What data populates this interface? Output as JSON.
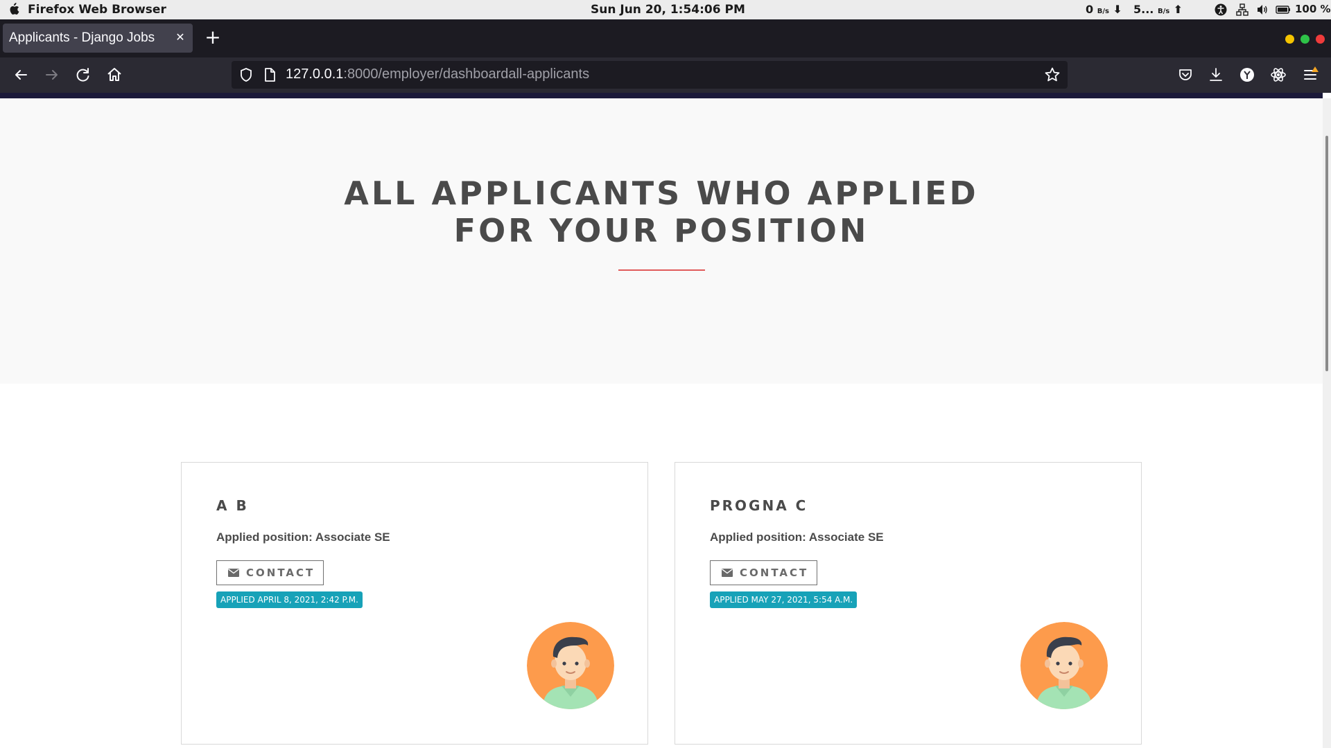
{
  "os": {
    "app_name": "Firefox Web Browser",
    "clock": "Sun Jun 20,  1:54:06 PM",
    "net_down_value": "0",
    "net_down_unit": "B/s",
    "net_up_value": "5...",
    "net_up_unit": "B/s",
    "battery": "100 %"
  },
  "browser": {
    "tab_title": "Applicants - Django Jobs",
    "url_host": "127.0.0.1",
    "url_path": ":8000/employer/dashboardall-applicants"
  },
  "page": {
    "title_line1": "ALL APPLICANTS WHO APPLIED",
    "title_line2": "FOR YOUR POSITION",
    "accent_color": "#e05a5a",
    "badge_color": "#17a2b8",
    "applicants": [
      {
        "name": "A B",
        "position": "Applied position: Associate SE",
        "contact_label": "CONTACT",
        "applied": "APPLIED APRIL 8, 2021, 2:42 P.M."
      },
      {
        "name": "PROGNA C",
        "position": "Applied position: Associate SE",
        "contact_label": "CONTACT",
        "applied": "APPLIED MAY 27, 2021, 5:54 A.M."
      }
    ]
  },
  "icons": [
    "apple-icon",
    "download-arrow-icon",
    "upload-arrow-icon",
    "accessibility-icon",
    "network-icon",
    "volume-icon",
    "battery-icon",
    "close-icon",
    "plus-icon",
    "back-icon",
    "forward-icon",
    "reload-icon",
    "home-icon",
    "shield-icon",
    "page-icon",
    "bookmark-star-icon",
    "pocket-icon",
    "downloads-icon",
    "account-icon",
    "extensions-icon",
    "menu-icon",
    "mail-icon",
    "avatar-icon"
  ]
}
